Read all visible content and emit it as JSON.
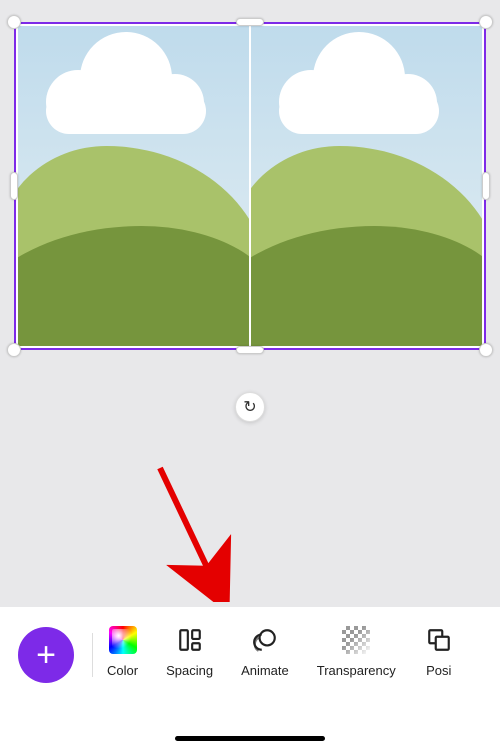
{
  "selection": {
    "accent": "#7d2ae8"
  },
  "swap_icon": "↻",
  "toolbar": {
    "fab_label": "+",
    "tools": [
      {
        "id": "color",
        "label": "Color"
      },
      {
        "id": "spacing",
        "label": "Spacing"
      },
      {
        "id": "animate",
        "label": "Animate"
      },
      {
        "id": "transparency",
        "label": "Transparency"
      },
      {
        "id": "position",
        "label": "Posi"
      }
    ]
  },
  "annotation": {
    "arrow_target": "spacing"
  }
}
